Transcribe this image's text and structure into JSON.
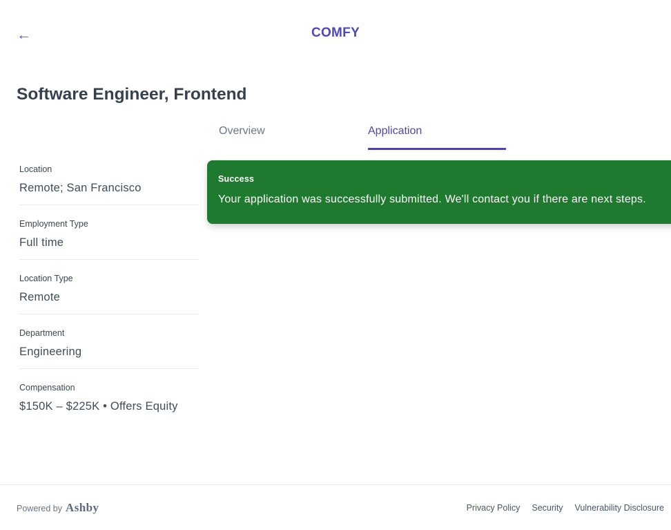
{
  "header": {
    "back_icon": "←",
    "logo": "COMFY"
  },
  "page_title": "Software Engineer, Frontend",
  "tabs": [
    {
      "label": "Overview",
      "active": false
    },
    {
      "label": "Application",
      "active": true
    }
  ],
  "job_details": [
    {
      "label": "Location",
      "value": "Remote; San Francisco"
    },
    {
      "label": "Employment Type",
      "value": "Full time"
    },
    {
      "label": "Location Type",
      "value": "Remote"
    },
    {
      "label": "Department",
      "value": "Engineering"
    },
    {
      "label": "Compensation",
      "value": "$150K – $225K • Offers Equity"
    }
  ],
  "banner": {
    "title": "Success",
    "message": "Your application was successfully submitted. We'll contact you if there are next steps."
  },
  "footer": {
    "powered_by": "Powered by",
    "brand": "Ashby",
    "links": [
      "Privacy Policy",
      "Security",
      "Vulnerability Disclosure"
    ]
  },
  "colors": {
    "accent_purple": "#4f46c0",
    "success_green": "#1e7a2e",
    "heading_text": "#36404e",
    "divider": "#e6e8eb"
  }
}
